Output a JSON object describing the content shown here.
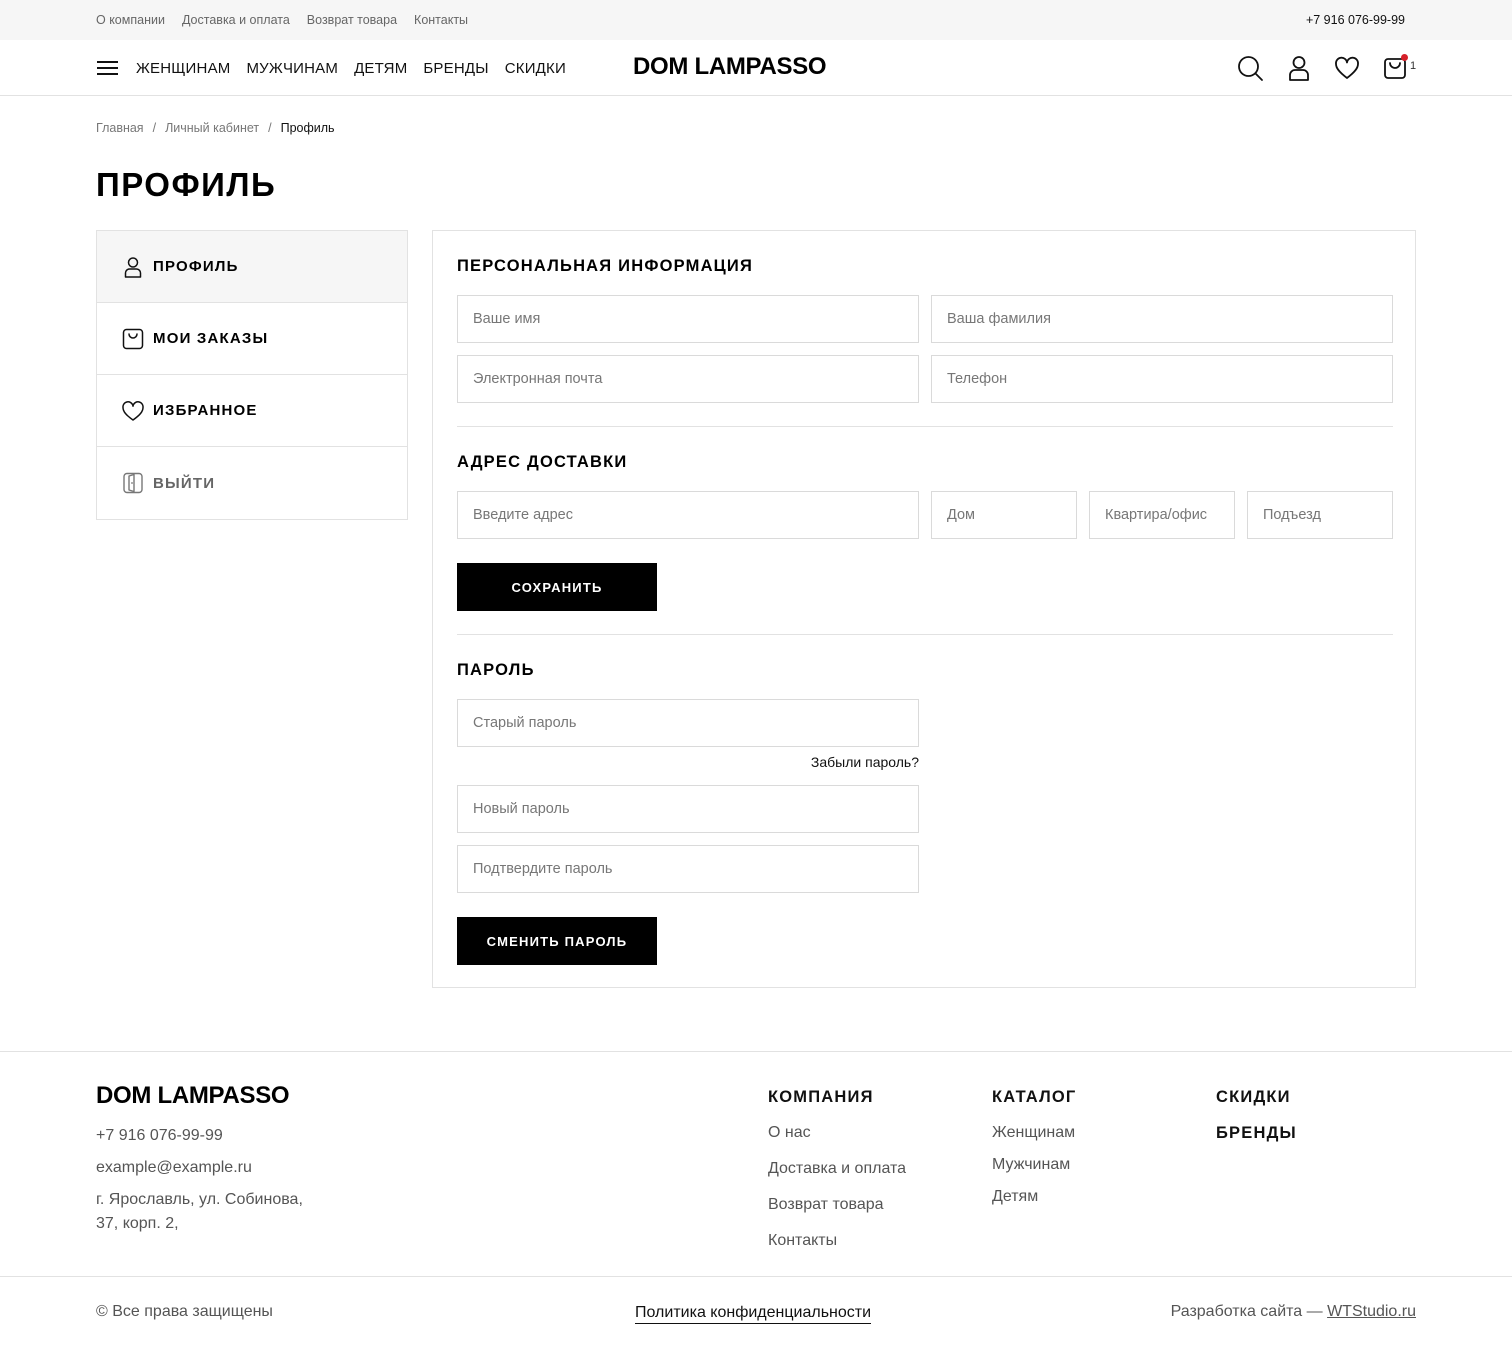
{
  "topbar": {
    "links": [
      "О компании",
      "Доставка и оплата",
      "Возврат товара",
      "Контакты"
    ],
    "phone": "+7 916 076-99-99"
  },
  "header": {
    "nav": [
      "ЖЕНЩИНАМ",
      "МУЖЧИНАМ",
      "ДЕТЯМ",
      "БРЕНДЫ",
      "СКИДКИ"
    ],
    "logo": "DOM LAMPASSO",
    "cart_count": "1",
    "icons": [
      "menu-icon",
      "search-icon",
      "user-icon",
      "heart-icon",
      "bag-icon"
    ],
    "cart_dot_color": "#d6202a"
  },
  "breadcrumb": {
    "items": [
      "Главная",
      "Личный кабинет"
    ],
    "separator": "/",
    "current": "Профиль"
  },
  "page_title": "ПРОФИЛЬ",
  "sidebar": {
    "items": [
      {
        "label": "ПРОФИЛЬ",
        "icon": "user-icon",
        "active": true
      },
      {
        "label": "МОИ ЗАКАЗЫ",
        "icon": "bag-icon",
        "active": false
      },
      {
        "label": "ИЗБРАННОЕ",
        "icon": "heart-icon",
        "active": false
      },
      {
        "label": "ВЫЙТИ",
        "icon": "logout-door-icon",
        "active": false
      }
    ]
  },
  "personal": {
    "title": "ПЕРСОНАЛЬНАЯ ИНФОРМАЦИЯ",
    "first_name_placeholder": "Ваше имя",
    "last_name_placeholder": "Ваша фамилия",
    "email_placeholder": "Электронная почта",
    "phone_placeholder": "Телефон"
  },
  "delivery": {
    "title": "АДРЕС ДОСТАВКИ",
    "address_placeholder": "Введите адрес",
    "house_placeholder": "Дом",
    "apartment_placeholder": "Квартира/офис",
    "entrance_placeholder": "Подъезд",
    "save_label": "СОХРАНИТЬ"
  },
  "password": {
    "title": "ПАРОЛЬ",
    "old_placeholder": "Старый пароль",
    "forgot_label": "Забыли пароль?",
    "new_placeholder": "Новый пароль",
    "confirm_placeholder": "Подтвердите пароль",
    "change_label": "СМЕНИТЬ ПАРОЛЬ"
  },
  "footer": {
    "logo": "DOM LAMPASSO",
    "phone": "+7 916 076-99-99",
    "email": "example@example.ru",
    "address_line1": "г. Ярославль, ул. Собинова,",
    "address_line2": "37, корп. 2,",
    "company": {
      "title": "КОМПАНИЯ",
      "links": [
        "О нас",
        "Доставка и оплата",
        "Возврат товара",
        "Контакты"
      ]
    },
    "catalog": {
      "title": "КАТАЛОГ",
      "links": [
        "Женщинам",
        "Мужчинам",
        "Детям"
      ]
    },
    "discounts": "СКИДКИ",
    "brands": "БРЕНДЫ",
    "copyright": "© Все права защищены",
    "policy": "Политика конфиденциальности",
    "dev_prefix": "Разработка сайта — ",
    "dev_link": "WTStudio.ru"
  }
}
